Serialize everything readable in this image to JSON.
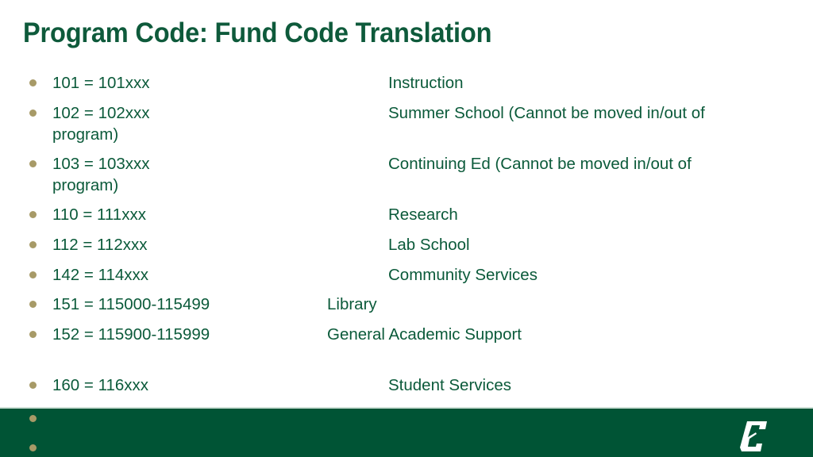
{
  "slide": {
    "title": "Program Code: Fund Code Translation",
    "colors": {
      "title": "#0e5a3b",
      "text": "#0b5a3a",
      "bullet": "#a79a67",
      "footer": "#005435"
    },
    "items": [
      {
        "code": "101 = 101xxx",
        "description": "Instruction",
        "continuation": ""
      },
      {
        "code": "102 = 102xxx",
        "description": "Summer School (Cannot be moved in/out of",
        "continuation": "program)"
      },
      {
        "code": "103 = 103xxx",
        "description": "Continuing Ed (Cannot be moved in/out of",
        "continuation": "program)"
      },
      {
        "code": "110 = 111xxx",
        "description": "Research",
        "continuation": ""
      },
      {
        "code": "112 = 112xxx",
        "description": "Lab School",
        "continuation": ""
      },
      {
        "code": "142 = 114xxx",
        "description": "Community Services",
        "continuation": ""
      },
      {
        "code": "151 = 115000-115499",
        "description": "Library",
        "continuation": ""
      },
      {
        "code": "152 = 115900-115999",
        "description": "General Academic Support",
        "continuation": ""
      },
      {
        "code": "160 = 116xxx",
        "description": "Student Services",
        "continuation": ""
      }
    ],
    "footer": {
      "logo_icon": "university-c-logo-icon"
    }
  }
}
